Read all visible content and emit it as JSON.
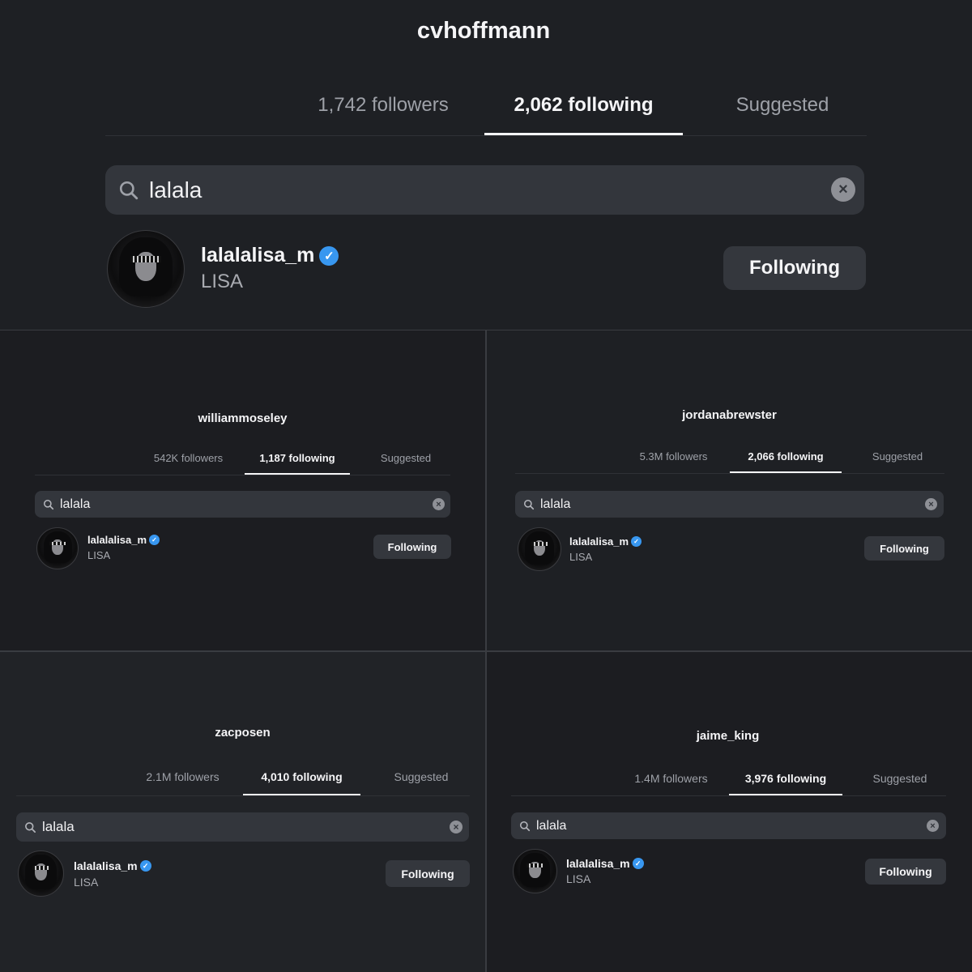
{
  "main": {
    "title": "cvhoffmann",
    "tabs": [
      "1,742 followers",
      "2,062 following",
      "Suggested"
    ],
    "search_query": "lalala",
    "result": {
      "username": "lalalalisa_m",
      "name": "LISA",
      "button": "Following"
    }
  },
  "panels": [
    {
      "title": "williammoseley",
      "tabs": [
        "542K followers",
        "1,187 following",
        "Suggested"
      ],
      "search_query": "lalala",
      "result": {
        "username": "lalalalisa_m",
        "name": "LISA",
        "button": "Following"
      }
    },
    {
      "title": "jordanabrewster",
      "tabs": [
        "5.3M followers",
        "2,066 following",
        "Suggested"
      ],
      "search_query": "lalala",
      "result": {
        "username": "lalalalisa_m",
        "name": "LISA",
        "button": "Following"
      }
    },
    {
      "title": "zacposen",
      "tabs": [
        "2.1M followers",
        "4,010 following",
        "Suggested"
      ],
      "search_query": "lalala",
      "result": {
        "username": "lalalalisa_m",
        "name": "LISA",
        "button": "Following"
      }
    },
    {
      "title": "jaime_king",
      "tabs": [
        "1.4M followers",
        "3,976 following",
        "Suggested"
      ],
      "search_query": "lalala",
      "result": {
        "username": "lalalalisa_m",
        "name": "LISA",
        "button": "Following"
      }
    }
  ],
  "icons": {
    "search": "search-icon",
    "clear": "clear-search-icon",
    "verified": "verified-badge-icon",
    "avatar": "avatar"
  },
  "colors": {
    "background": "#1e2024",
    "search_field": "#33363c",
    "button": "#34373d",
    "verified": "#3897f0"
  }
}
